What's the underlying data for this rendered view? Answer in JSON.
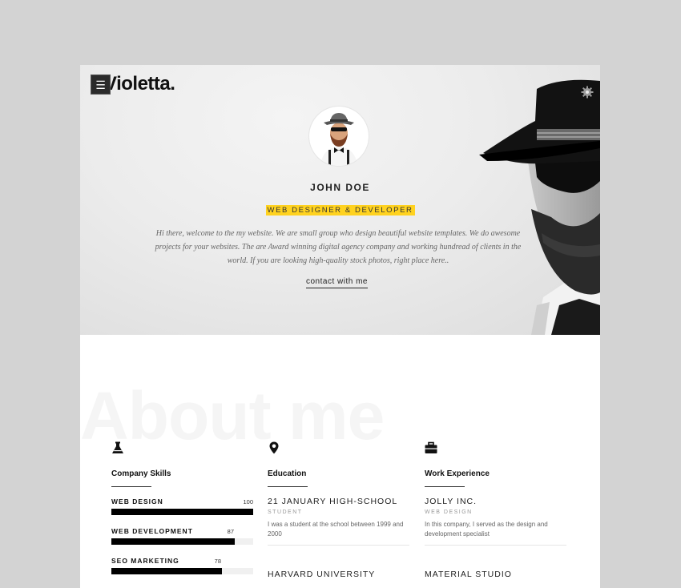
{
  "brand": {
    "logo": "Violetta.",
    "menu_icon": "hamburger-icon",
    "settings_icon": "gear-icon"
  },
  "hero": {
    "name": "JOHN DOE",
    "role": "WEB DESIGNER & DEVELOPER",
    "intro": "Hi there, welcome to the my website. We are small group who design beautiful website templates. We do awesome projects for your websites. The are Award winning digital agency company and working hundread of clients in the world. If you are looking high-quality stock photos, right place here..",
    "contact_label": "contact with me",
    "highlight_color": "#ffd21f"
  },
  "about": {
    "heading": "About me",
    "skills": {
      "title": "Company Skills",
      "icon": "flask-icon",
      "items": [
        {
          "label": "WEB DESIGN",
          "value": 100
        },
        {
          "label": "WEB DEVELOPMENT",
          "value": 87
        },
        {
          "label": "SEO MARKETING",
          "value": 78
        }
      ]
    },
    "education": {
      "title": "Education",
      "icon": "map-pin-icon",
      "items": [
        {
          "title": "21 JANUARY HIGH-SCHOOL",
          "subtitle": "STUDENT",
          "desc": "I was a student at the school between 1999 and 2000"
        },
        {
          "title": "HARVARD UNIVERSITY",
          "subtitle": "",
          "desc": ""
        }
      ]
    },
    "work": {
      "title": "Work Experience",
      "icon": "briefcase-icon",
      "items": [
        {
          "title": "JOLLY INC.",
          "subtitle": "WEB DESIGN",
          "desc": "In this company, I served as the design and development specialist"
        },
        {
          "title": "MATERIAL STUDIO",
          "subtitle": "",
          "desc": ""
        }
      ]
    }
  }
}
